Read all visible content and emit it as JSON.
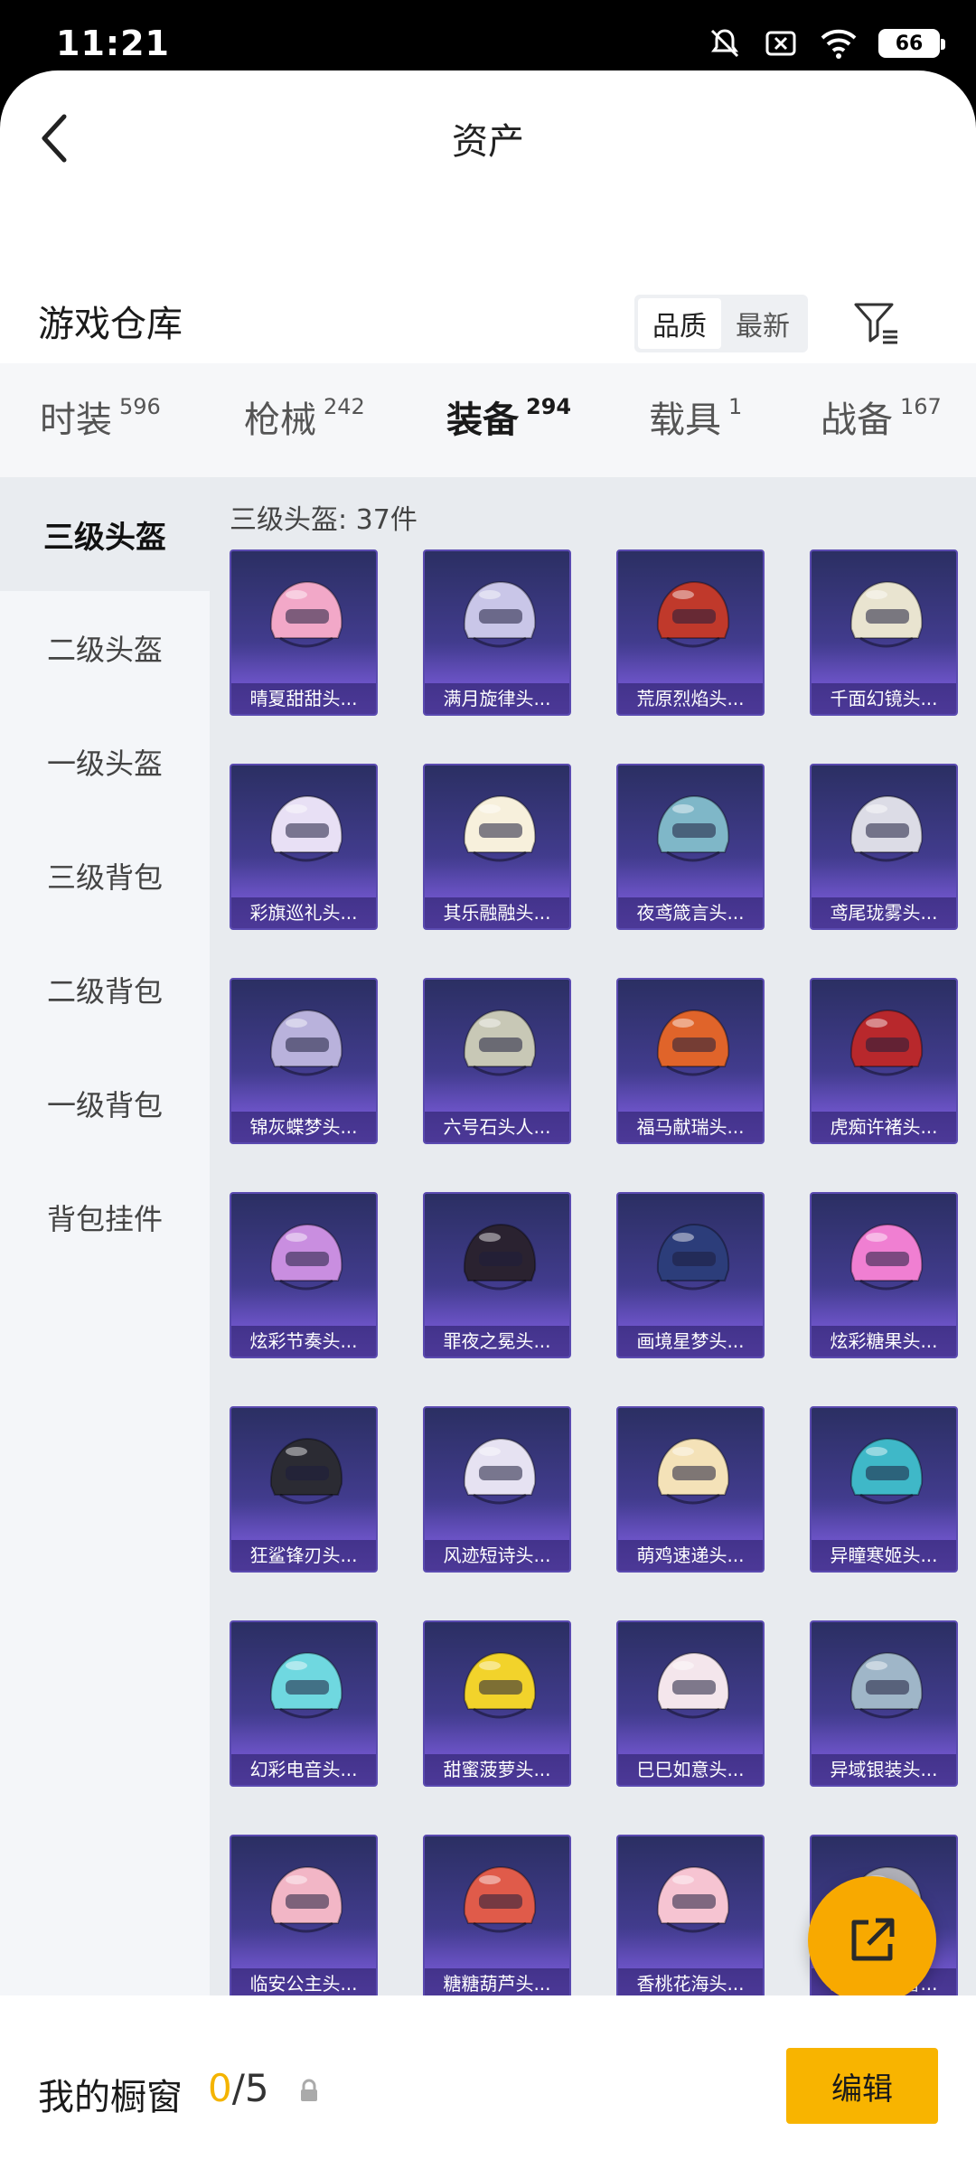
{
  "status": {
    "time": "11:21",
    "battery": "66"
  },
  "header": {
    "title": "资产"
  },
  "repo": {
    "title": "游戏仓库",
    "sort_options": [
      "品质",
      "最新"
    ]
  },
  "tabs": [
    {
      "label": "时装",
      "count": "596"
    },
    {
      "label": "枪械",
      "count": "242"
    },
    {
      "label": "装备",
      "count": "294",
      "active": true
    },
    {
      "label": "载具",
      "count": "1"
    },
    {
      "label": "战备",
      "count": "167"
    }
  ],
  "sidebar": {
    "items": [
      {
        "label": "三级头盔",
        "active": true
      },
      {
        "label": "二级头盔"
      },
      {
        "label": "一级头盔"
      },
      {
        "label": "三级背包"
      },
      {
        "label": "二级背包"
      },
      {
        "label": "一级背包"
      },
      {
        "label": "背包挂件"
      }
    ]
  },
  "content": {
    "heading": "三级头盔: 37件",
    "items": [
      {
        "name": "晴夏甜甜头...",
        "color": "#f2a8c8"
      },
      {
        "name": "满月旋律头...",
        "color": "#c9c6e8"
      },
      {
        "name": "荒原烈焰头...",
        "color": "#c0392b"
      },
      {
        "name": "千面幻镜头...",
        "color": "#e9e4d0"
      },
      {
        "name": "彩旗巡礼头...",
        "color": "#e8e0f5"
      },
      {
        "name": "其乐融融头...",
        "color": "#f7f0dc"
      },
      {
        "name": "夜鸢箴言头...",
        "color": "#7fb7c8"
      },
      {
        "name": "鸢尾珑雾头...",
        "color": "#dcdce6"
      },
      {
        "name": "锦灰蝶梦头...",
        "color": "#b9b2dc"
      },
      {
        "name": "六号石头人...",
        "color": "#c8c8b6"
      },
      {
        "name": "福马献瑞头...",
        "color": "#e0642a"
      },
      {
        "name": "虎痴许褚头...",
        "color": "#b8282c"
      },
      {
        "name": "炫彩节奏头...",
        "color": "#c98ee0"
      },
      {
        "name": "罪夜之冕头...",
        "color": "#2a2230"
      },
      {
        "name": "画境星梦头...",
        "color": "#2c3d7a"
      },
      {
        "name": "炫彩糖果头...",
        "color": "#f07fd2"
      },
      {
        "name": "狂鲨锋刃头...",
        "color": "#2b2b33"
      },
      {
        "name": "风迹短诗头...",
        "color": "#e6e2f2"
      },
      {
        "name": "萌鸡速递头...",
        "color": "#f4e2b8"
      },
      {
        "name": "异瞳寒姬头...",
        "color": "#3fb8c8"
      },
      {
        "name": "幻彩电音头...",
        "color": "#6fd8e0"
      },
      {
        "name": "甜蜜菠萝头...",
        "color": "#f2d32b"
      },
      {
        "name": "巳巳如意头...",
        "color": "#f4e6ec"
      },
      {
        "name": "异域银装头...",
        "color": "#9fb6c8"
      },
      {
        "name": "临安公主头...",
        "color": "#f2b6c6"
      },
      {
        "name": "糖糖葫芦头...",
        "color": "#e05b4a"
      },
      {
        "name": "香桃花海头...",
        "color": "#f6c4d2"
      },
      {
        "name": "未来领航者...",
        "color": "#b0b0b8"
      }
    ]
  },
  "bottom": {
    "window_label": "我的橱窗",
    "current": "0",
    "total": "/5",
    "edit_label": "编辑"
  }
}
